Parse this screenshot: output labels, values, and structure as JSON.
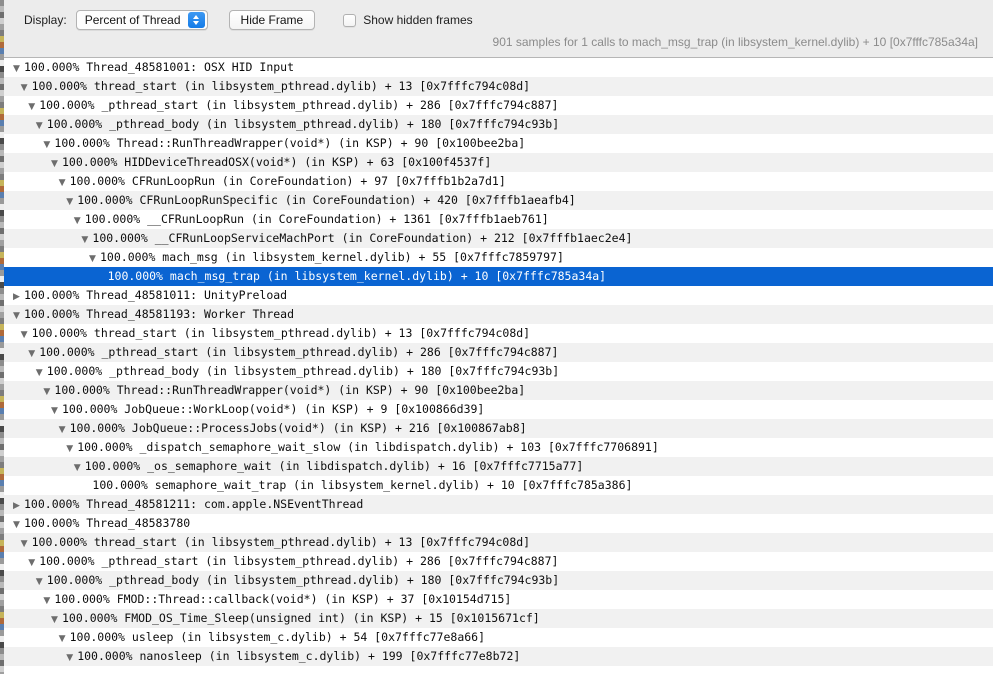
{
  "toolbar": {
    "display_label": "Display:",
    "display_value": "Percent of Thread",
    "display_options": [
      "Percent of Thread"
    ],
    "hide_frame_label": "Hide Frame",
    "show_hidden_label": "Show hidden frames",
    "show_hidden_checked": false,
    "samples_text": "901 samples for 1 calls to mach_msg_trap  (in libsystem_kernel.dylib) + 10  [0x7fffc785a34a]"
  },
  "colors": {
    "selection": "#0a64d2",
    "toolbar_bg": "#ececec",
    "alt_row": "#f1f1f1",
    "popup_arrow": "#2c8cf0"
  },
  "tree": {
    "rows": [
      {
        "depth": 0,
        "disclosure": "expanded",
        "text": "100.000% Thread_48581001: OSX HID Input",
        "selected": false
      },
      {
        "depth": 1,
        "disclosure": "expanded",
        "text": "100.000% thread_start  (in libsystem_pthread.dylib) + 13  [0x7fffc794c08d]",
        "selected": false
      },
      {
        "depth": 2,
        "disclosure": "expanded",
        "text": "100.000% _pthread_start  (in libsystem_pthread.dylib) + 286  [0x7fffc794c887]",
        "selected": false
      },
      {
        "depth": 3,
        "disclosure": "expanded",
        "text": "100.000% _pthread_body  (in libsystem_pthread.dylib) + 180  [0x7fffc794c93b]",
        "selected": false
      },
      {
        "depth": 4,
        "disclosure": "expanded",
        "text": "100.000% Thread::RunThreadWrapper(void*)  (in KSP) + 90  [0x100bee2ba]",
        "selected": false
      },
      {
        "depth": 5,
        "disclosure": "expanded",
        "text": "100.000% HIDDeviceThreadOSX(void*)  (in KSP) + 63  [0x100f4537f]",
        "selected": false
      },
      {
        "depth": 6,
        "disclosure": "expanded",
        "text": "100.000% CFRunLoopRun  (in CoreFoundation) + 97  [0x7fffb1b2a7d1]",
        "selected": false
      },
      {
        "depth": 7,
        "disclosure": "expanded",
        "text": "100.000% CFRunLoopRunSpecific  (in CoreFoundation) + 420  [0x7fffb1aeafb4]",
        "selected": false
      },
      {
        "depth": 8,
        "disclosure": "expanded",
        "text": "100.000% __CFRunLoopRun  (in CoreFoundation) + 1361  [0x7fffb1aeb761]",
        "selected": false
      },
      {
        "depth": 9,
        "disclosure": "expanded",
        "text": "100.000% __CFRunLoopServiceMachPort  (in CoreFoundation) + 212  [0x7fffb1aec2e4]",
        "selected": false
      },
      {
        "depth": 10,
        "disclosure": "expanded",
        "text": "100.000% mach_msg  (in libsystem_kernel.dylib) + 55  [0x7fffc7859797]",
        "selected": false
      },
      {
        "depth": 11,
        "disclosure": "none",
        "text": "100.000% mach_msg_trap  (in libsystem_kernel.dylib) + 10  [0x7fffc785a34a]",
        "selected": true
      },
      {
        "depth": 0,
        "disclosure": "collapsed",
        "text": "100.000% Thread_48581011: UnityPreload",
        "selected": false
      },
      {
        "depth": 0,
        "disclosure": "expanded",
        "text": "100.000% Thread_48581193: Worker Thread",
        "selected": false
      },
      {
        "depth": 1,
        "disclosure": "expanded",
        "text": "100.000% thread_start  (in libsystem_pthread.dylib) + 13  [0x7fffc794c08d]",
        "selected": false
      },
      {
        "depth": 2,
        "disclosure": "expanded",
        "text": "100.000% _pthread_start  (in libsystem_pthread.dylib) + 286  [0x7fffc794c887]",
        "selected": false
      },
      {
        "depth": 3,
        "disclosure": "expanded",
        "text": "100.000% _pthread_body  (in libsystem_pthread.dylib) + 180  [0x7fffc794c93b]",
        "selected": false
      },
      {
        "depth": 4,
        "disclosure": "expanded",
        "text": "100.000% Thread::RunThreadWrapper(void*)  (in KSP) + 90  [0x100bee2ba]",
        "selected": false
      },
      {
        "depth": 5,
        "disclosure": "expanded",
        "text": "100.000% JobQueue::WorkLoop(void*)  (in KSP) + 9  [0x100866d39]",
        "selected": false
      },
      {
        "depth": 6,
        "disclosure": "expanded",
        "text": "100.000% JobQueue::ProcessJobs(void*)  (in KSP) + 216  [0x100867ab8]",
        "selected": false
      },
      {
        "depth": 7,
        "disclosure": "expanded",
        "text": "100.000% _dispatch_semaphore_wait_slow  (in libdispatch.dylib) + 103  [0x7fffc7706891]",
        "selected": false
      },
      {
        "depth": 8,
        "disclosure": "expanded",
        "text": "100.000% _os_semaphore_wait  (in libdispatch.dylib) + 16  [0x7fffc7715a77]",
        "selected": false
      },
      {
        "depth": 9,
        "disclosure": "none",
        "text": "100.000% semaphore_wait_trap  (in libsystem_kernel.dylib) + 10  [0x7fffc785a386]",
        "selected": false
      },
      {
        "depth": 0,
        "disclosure": "collapsed",
        "text": "100.000% Thread_48581211: com.apple.NSEventThread",
        "selected": false
      },
      {
        "depth": 0,
        "disclosure": "expanded",
        "text": "100.000% Thread_48583780",
        "selected": false
      },
      {
        "depth": 1,
        "disclosure": "expanded",
        "text": "100.000% thread_start  (in libsystem_pthread.dylib) + 13  [0x7fffc794c08d]",
        "selected": false
      },
      {
        "depth": 2,
        "disclosure": "expanded",
        "text": "100.000% _pthread_start  (in libsystem_pthread.dylib) + 286  [0x7fffc794c887]",
        "selected": false
      },
      {
        "depth": 3,
        "disclosure": "expanded",
        "text": "100.000% _pthread_body  (in libsystem_pthread.dylib) + 180  [0x7fffc794c93b]",
        "selected": false
      },
      {
        "depth": 4,
        "disclosure": "expanded",
        "text": "100.000% FMOD::Thread::callback(void*)  (in KSP) + 37  [0x10154d715]",
        "selected": false
      },
      {
        "depth": 5,
        "disclosure": "expanded",
        "text": "100.000% FMOD_OS_Time_Sleep(unsigned int)  (in KSP) + 15  [0x1015671cf]",
        "selected": false
      },
      {
        "depth": 6,
        "disclosure": "expanded",
        "text": "100.000% usleep  (in libsystem_c.dylib) + 54  [0x7fffc77e8a66]",
        "selected": false
      },
      {
        "depth": 7,
        "disclosure": "expanded",
        "text": "100.000% nanosleep  (in libsystem_c.dylib) + 199  [0x7fffc77e8b72]",
        "selected": false
      }
    ],
    "glyphs": {
      "expanded": "▼",
      "collapsed": "▶",
      "none": ""
    }
  }
}
